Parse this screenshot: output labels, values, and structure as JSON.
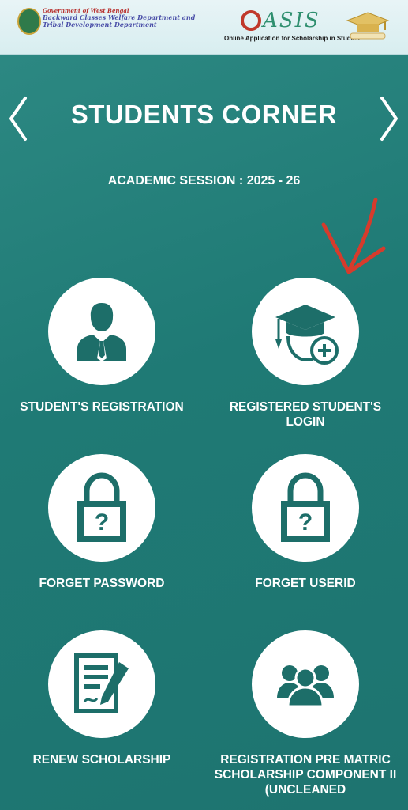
{
  "header": {
    "gov_line1": "Government of West Bengal",
    "gov_line2": "Backward Classes Welfare Department and",
    "gov_line3": "Tribal Development Department",
    "logo_text": "ASIS",
    "logo_subtitle": "Online Application for Scholarship in Studies"
  },
  "page": {
    "title": "STUDENTS CORNER",
    "session": "ACADEMIC SESSION : 2025 - 26"
  },
  "tiles": [
    {
      "label": "STUDENT'S REGISTRATION",
      "icon": "user-suit-icon"
    },
    {
      "label": "REGISTERED STUDENT'S LOGIN",
      "icon": "graduate-plus-icon"
    },
    {
      "label": "FORGET PASSWORD",
      "icon": "lock-question-icon"
    },
    {
      "label": "FORGET USERID",
      "icon": "lock-question-icon"
    },
    {
      "label": "RENEW SCHOLARSHIP",
      "icon": "document-sign-icon"
    },
    {
      "label": "REGISTRATION PRE MATRIC SCHOLARSHIP COMPONENT II (UNCLEANED",
      "icon": "group-icon"
    }
  ],
  "colors": {
    "background": "#1f7a75",
    "icon": "#1d6e69",
    "annotation_arrow": "#d63b2c"
  }
}
